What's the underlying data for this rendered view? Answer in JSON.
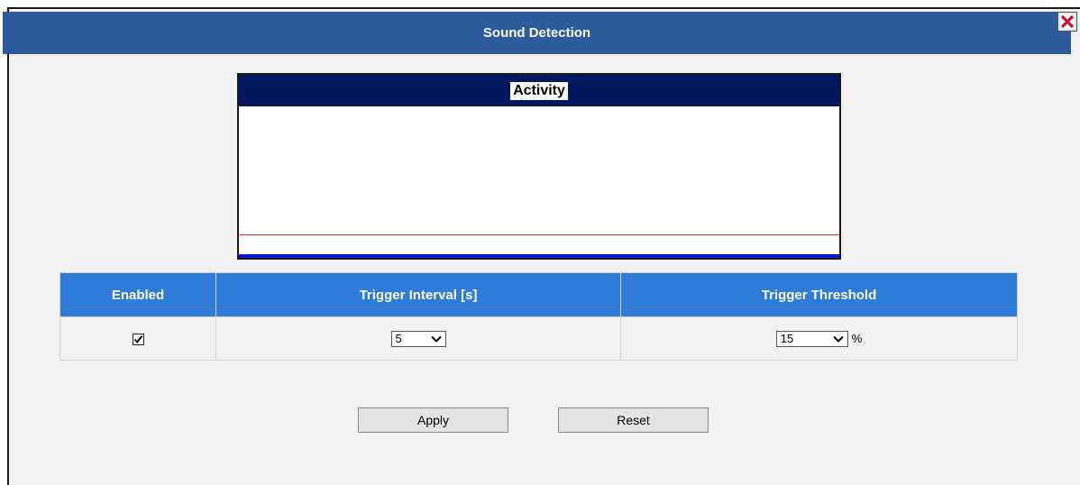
{
  "window": {
    "title": "Sound Detection",
    "close_icon": "close-icon",
    "colors": {
      "titlebar": "#2e5b9e",
      "header": "#2f7bd8",
      "background": "#f2f2f2"
    }
  },
  "activity": {
    "title": "Activity",
    "colors": {
      "header": "#02185e",
      "threshold_line": "#e02020",
      "baseline": "#0018e0"
    }
  },
  "table": {
    "headers": [
      "Enabled",
      "Trigger Interval [s]",
      "Trigger Threshold"
    ],
    "enabled": true,
    "trigger_interval": "5",
    "trigger_threshold": "15",
    "threshold_unit": "%"
  },
  "buttons": {
    "apply": "Apply",
    "reset": "Reset"
  }
}
